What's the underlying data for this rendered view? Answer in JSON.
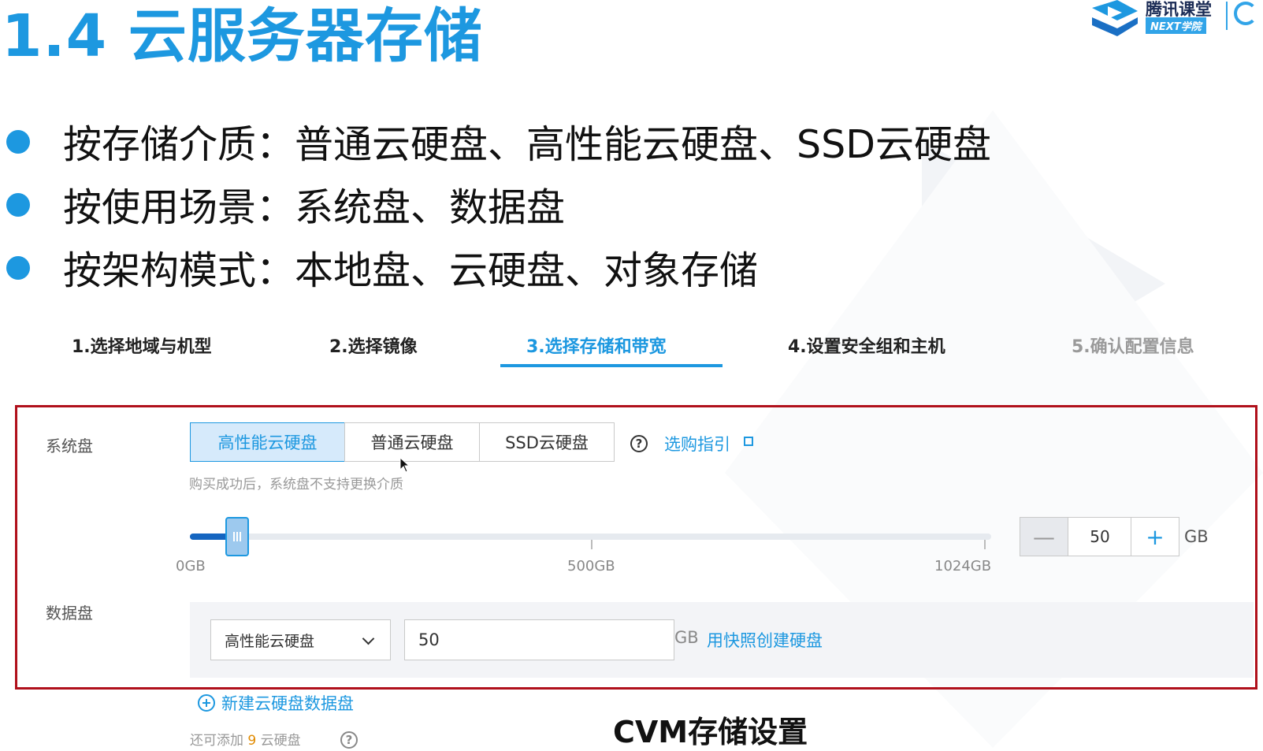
{
  "slide": {
    "title": "1.4 云服务器存储",
    "logo": {
      "name": "腾讯课堂",
      "sub": "NEXT学院"
    },
    "bullets": [
      "按存储介质：普通云硬盘、高性能云硬盘、SSD云硬盘",
      "按使用场景：系统盘、数据盘",
      "按架构模式：本地盘、云硬盘、对象存储"
    ],
    "caption": "CVM存储设置"
  },
  "steps": [
    {
      "label": "1.选择地域与机型",
      "state": "done"
    },
    {
      "label": "2.选择镜像",
      "state": "done"
    },
    {
      "label": "3.选择存储和带宽",
      "state": "active"
    },
    {
      "label": "4.设置安全组和主机",
      "state": "done"
    },
    {
      "label": "5.确认配置信息",
      "state": "pending"
    }
  ],
  "system_disk": {
    "label": "系统盘",
    "types": [
      "高性能云硬盘",
      "普通云硬盘",
      "SSD云硬盘"
    ],
    "selected_type": "高性能云硬盘",
    "help_icon": "?",
    "guide_link": "选购指引",
    "hint": "购买成功后，系统盘不支持更换介质",
    "slider": {
      "min_label": "0GB",
      "mid_label": "500GB",
      "max_label": "1024GB",
      "value": 50,
      "max": 1024
    },
    "stepper": {
      "minus": "—",
      "value": "50",
      "plus": "+",
      "unit": "GB"
    }
  },
  "data_disk": {
    "label": "数据盘",
    "type_select": "高性能云硬盘",
    "size_value": "50",
    "unit": "GB",
    "snapshot_link": "用快照创建硬盘",
    "add_link": "新建云硬盘数据盘",
    "remain_prefix": "还可添加",
    "remain_count": "9",
    "remain_suffix": "云硬盘",
    "help_icon": "?"
  },
  "colors": {
    "accent": "#1d98e0",
    "frame": "#b0101b",
    "slider_fill": "#1565c0"
  }
}
